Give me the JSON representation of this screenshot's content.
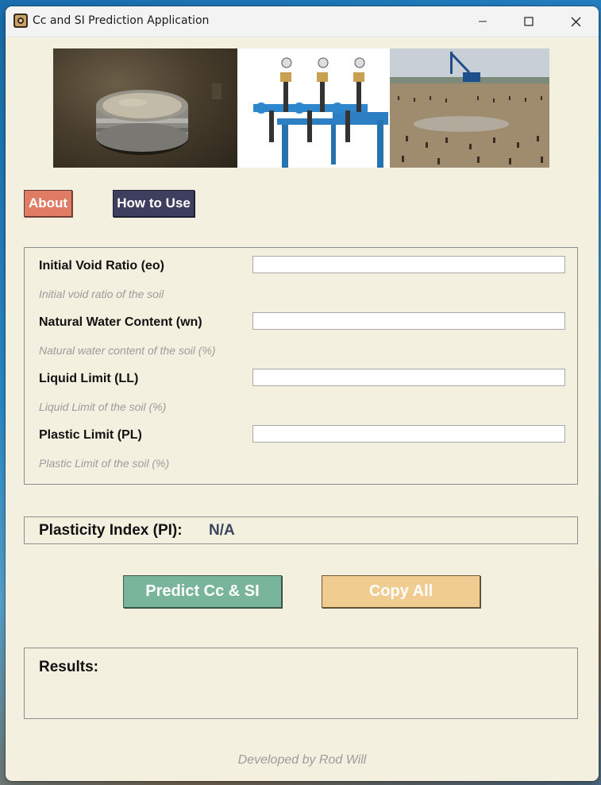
{
  "window": {
    "title": "Cc and SI Prediction Application",
    "controls": {
      "minimize": "–",
      "maximize": "☐",
      "close": "✕"
    }
  },
  "banner": {
    "images": [
      "soil-sample-icon",
      "consolidation-apparatus-icon",
      "construction-site-icon"
    ]
  },
  "toolbar": {
    "about_label": "About",
    "howto_label": "How to Use"
  },
  "fields": [
    {
      "label": "Initial Void Ratio (eo)",
      "hint": "Initial void ratio of the soil",
      "value": ""
    },
    {
      "label": "Natural Water Content (wn)",
      "hint": "Natural water content of the soil (%)",
      "value": ""
    },
    {
      "label": "Liquid Limit (LL)",
      "hint": "Liquid Limit of the soil (%)",
      "value": ""
    },
    {
      "label": "Plastic Limit (PL)",
      "hint": "Plastic Limit of the soil (%)",
      "value": ""
    }
  ],
  "plasticity": {
    "label": "Plasticity Index (PI):",
    "value": "N/A"
  },
  "actions": {
    "predict_label": "Predict Cc & SI",
    "copy_label": "Copy All"
  },
  "results": {
    "label": "Results:"
  },
  "footer": {
    "text": "Developed by Rod Will"
  },
  "colors": {
    "background": "#f3f0df",
    "about": "#e07c63",
    "howto": "#3e3e5e",
    "predict": "#79b59a",
    "copy": "#f0cc91",
    "pi_value": "#3b4660"
  }
}
